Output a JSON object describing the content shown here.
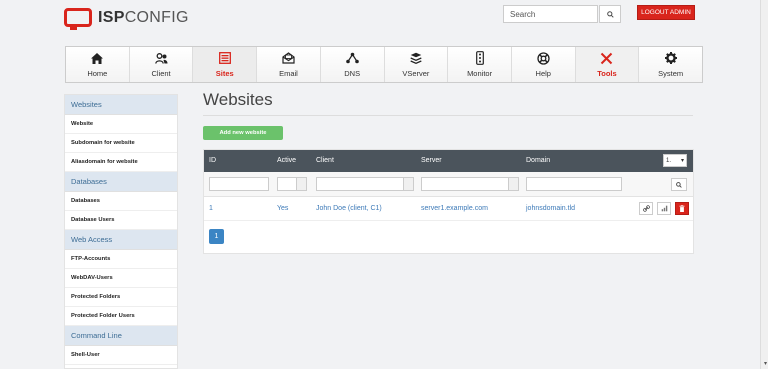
{
  "brand": {
    "name_bold": "ISP",
    "name_light": "CONFIG"
  },
  "header": {
    "search_placeholder": "Search",
    "logout_label": "LOGOUT ADMIN"
  },
  "nav": [
    {
      "label": "Home",
      "icon": "home-icon"
    },
    {
      "label": "Client",
      "icon": "users-icon"
    },
    {
      "label": "Sites",
      "icon": "sites-icon",
      "active": true
    },
    {
      "label": "Email",
      "icon": "email-icon"
    },
    {
      "label": "DNS",
      "icon": "dns-icon"
    },
    {
      "label": "VServer",
      "icon": "vserver-icon"
    },
    {
      "label": "Monitor",
      "icon": "monitor-icon"
    },
    {
      "label": "Help",
      "icon": "help-icon"
    },
    {
      "label": "Tools",
      "icon": "tools-icon"
    },
    {
      "label": "System",
      "icon": "gear-icon"
    }
  ],
  "sidebar": {
    "sections": [
      {
        "title": "Websites",
        "items": [
          "Website",
          "Subdomain for website",
          "Aliasdomain for website"
        ]
      },
      {
        "title": "Databases",
        "items": [
          "Databases",
          "Database Users"
        ]
      },
      {
        "title": "Web Access",
        "items": [
          "FTP-Accounts",
          "WebDAV-Users",
          "Protected Folders",
          "Protected Folder Users"
        ]
      },
      {
        "title": "Command Line",
        "items": [
          "Shell-User"
        ]
      }
    ]
  },
  "main": {
    "title": "Websites",
    "add_button": "Add new website",
    "page_size": "1.",
    "columns": {
      "id": "ID",
      "active": "Active",
      "client": "Client",
      "server": "Server",
      "domain": "Domain"
    },
    "rows": [
      {
        "id": "1",
        "active": "Yes",
        "client": "John Doe (client, C1)",
        "server": "server1.example.com",
        "domain": "johnsdomain.tld"
      }
    ],
    "pagination": {
      "current": "1"
    }
  },
  "colors": {
    "accent": "#d9251c",
    "primary": "#3b85c4",
    "success": "#6bc26b",
    "table_header": "#4b545c"
  }
}
